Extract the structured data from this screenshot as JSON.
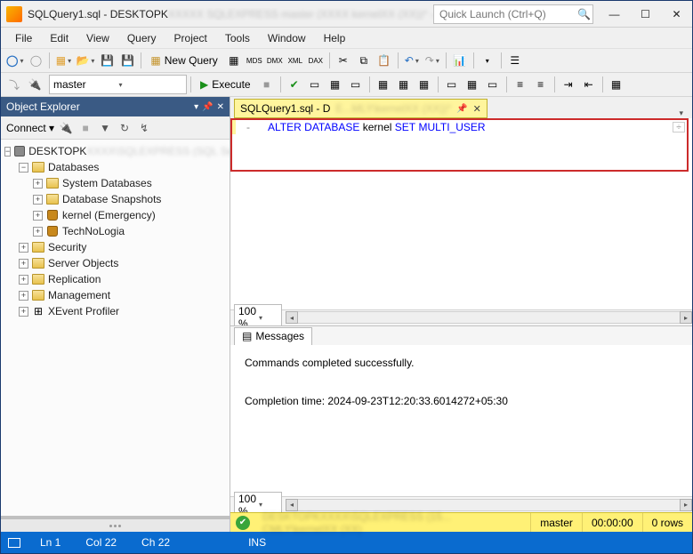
{
  "title": "SQLQuery1.sql - DESKTOPK",
  "quick_launch_placeholder": "Quick Launch (Ctrl+Q)",
  "menu": [
    "File",
    "Edit",
    "View",
    "Query",
    "Project",
    "Tools",
    "Window",
    "Help"
  ],
  "toolbar1": {
    "new_query": "New Query"
  },
  "toolbar2": {
    "database": "master",
    "execute": "Execute"
  },
  "object_explorer": {
    "title": "Object Explorer",
    "connect_label": "Connect",
    "tree": {
      "server": "DESKTOPK",
      "databases_label": "Databases",
      "db_children": [
        {
          "label": "System Databases"
        },
        {
          "label": "Database Snapshots"
        },
        {
          "label": "kernel (Emergency)"
        },
        {
          "label": "TechNoLogia"
        }
      ],
      "siblings": [
        "Security",
        "Server Objects",
        "Replication",
        "Management",
        "XEvent Profiler"
      ]
    }
  },
  "tab": {
    "label": "SQLQuery1.sql - D"
  },
  "sql": {
    "keyword_alter": "ALTER",
    "keyword_database": "DATABASE",
    "ident": "kernel",
    "keyword_set": "SET",
    "keyword_multi_user": "MULTI_USER"
  },
  "zoom1": "100 %",
  "zoom2": "100 %",
  "messages": {
    "tab": "Messages",
    "line1": "Commands completed successfully.",
    "line2": "Completion time: 2024-09-23T12:20:33.6014272+05:30"
  },
  "query_status": {
    "db": "master",
    "elapsed": "00:00:00",
    "rows": "0 rows"
  },
  "status": {
    "ln": "Ln 1",
    "col": "Col 22",
    "ch": "Ch 22",
    "ins": "INS"
  }
}
